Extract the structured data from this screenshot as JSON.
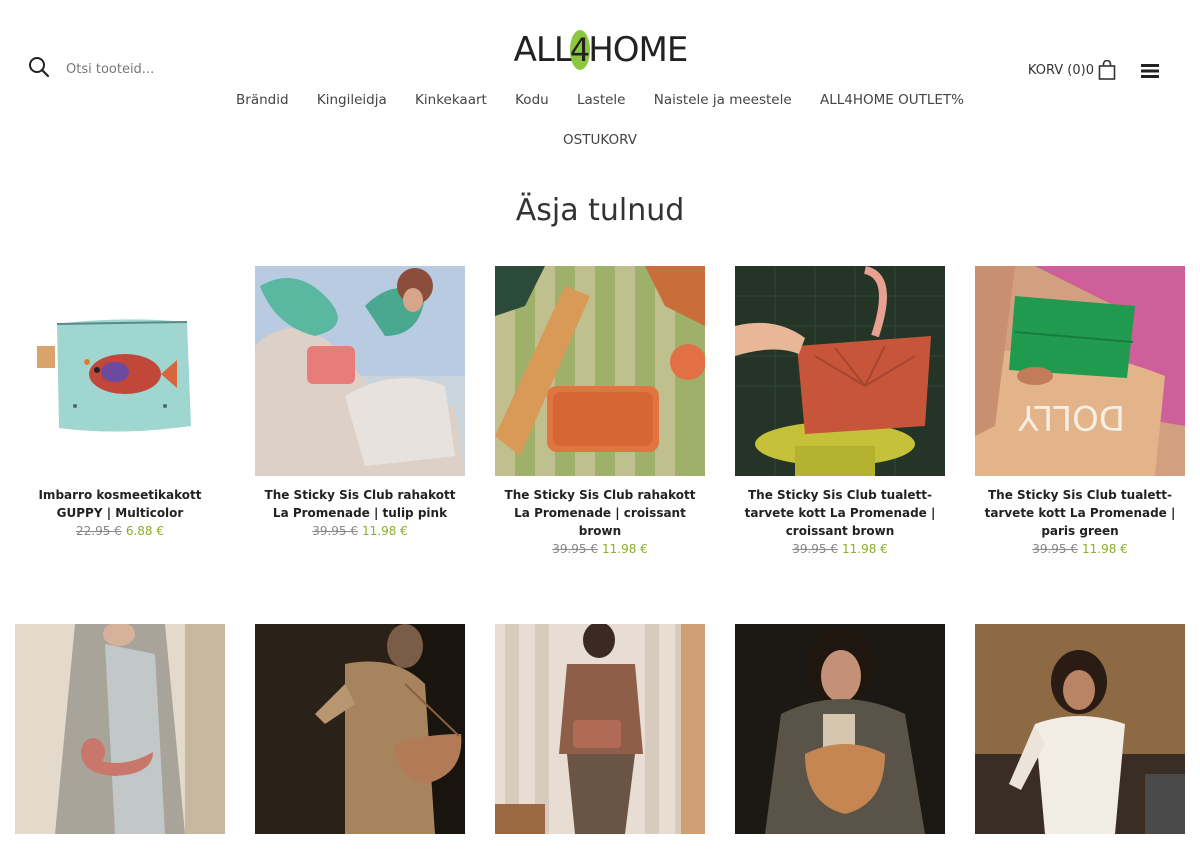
{
  "header": {
    "logo_text": "ALL4HOME",
    "search_placeholder": "Otsi tooteid...",
    "cart_label": "KORV (0)0"
  },
  "nav": {
    "items": [
      "Brändid",
      "Kingileidja",
      "Kinkekaart",
      "Kodu",
      "Lastele",
      "Naistele ja meestele",
      "ALL4HOME OUTLET%"
    ],
    "second_row": [
      "OSTUKORV"
    ]
  },
  "section": {
    "title": "Äsja tulnud"
  },
  "products": [
    {
      "name": "Imbarro kosmeetikakott GUPPY | Multicolor",
      "old_price": "22.95 €",
      "new_price": "6.88 €"
    },
    {
      "name": "The Sticky Sis Club rahakott La Promenade | tulip pink",
      "old_price": "39.95 €",
      "new_price": "11.98 €"
    },
    {
      "name": "The Sticky Sis Club rahakott La Promenade | croissant brown",
      "old_price": "39.95 €",
      "new_price": "11.98 €"
    },
    {
      "name": "The Sticky Sis Club tualett-tarvete kott La Promenade | croissant brown",
      "old_price": "39.95 €",
      "new_price": "11.98 €"
    },
    {
      "name": "The Sticky Sis Club tualett-tarvete kott La Promenade | paris green",
      "old_price": "39.95 €",
      "new_price": "11.98 €"
    }
  ],
  "colors": {
    "price_accent": "#8aaf2a",
    "logo_accent": "#8dc63f"
  }
}
